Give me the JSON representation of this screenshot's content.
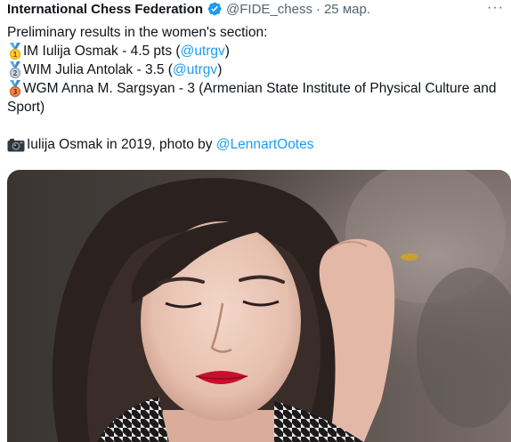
{
  "header": {
    "author_name": "International Chess Federation",
    "handle": "@FIDE_chess",
    "separator": "·",
    "date": "25 мар.",
    "more_glyph": "···"
  },
  "tweet": {
    "intro": "Preliminary results in the women's section:",
    "results": [
      {
        "medal": "gold-medal-icon",
        "place": "1",
        "text": "IM Iulija Osmak - 4.5 pts (",
        "link": "@utrgv",
        "suffix": ")"
      },
      {
        "medal": "silver-medal-icon",
        "place": "2",
        "text": "WIM Julia Antolak - 3.5 (",
        "link": "@utrgv",
        "suffix": ")"
      },
      {
        "medal": "bronze-medal-icon",
        "place": "3",
        "text": "WGM Anna M. Sargsyan - 3 (Armenian State Institute of Physical Culture and Sport)"
      }
    ],
    "caption_text": "Iulija Osmak in 2019, photo by ",
    "caption_link": "@LennartOotes"
  },
  "colors": {
    "text": "#0f1419",
    "secondary": "#536471",
    "link": "#1d9bf0",
    "verified": "#1d9bf0"
  }
}
